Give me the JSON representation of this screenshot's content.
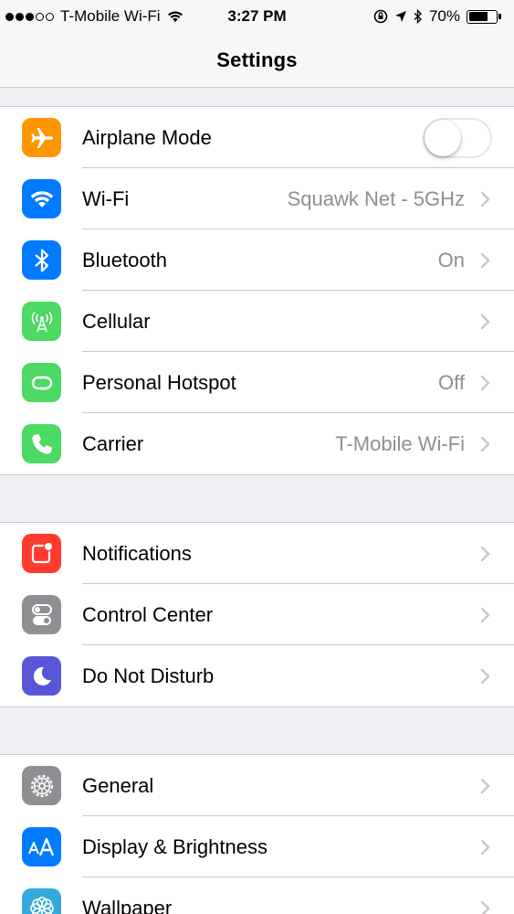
{
  "status_bar": {
    "carrier": "T-Mobile Wi-Fi",
    "time": "3:27 PM",
    "battery": "70%",
    "battery_level": 0.7,
    "signal_bars_filled": 3,
    "signal_bars_total": 5
  },
  "nav": {
    "title": "Settings"
  },
  "groups": [
    {
      "items": [
        {
          "label": "Airplane Mode",
          "icon": "airplane-icon",
          "color": "#ff9500",
          "toggle": false
        },
        {
          "label": "Wi-Fi",
          "value": "Squawk Net - 5GHz",
          "icon": "wifi-icon",
          "color": "#007aff"
        },
        {
          "label": "Bluetooth",
          "value": "On",
          "icon": "bluetooth-icon",
          "color": "#007aff"
        },
        {
          "label": "Cellular",
          "value": "",
          "icon": "cellular-icon",
          "color": "#4cd964"
        },
        {
          "label": "Personal Hotspot",
          "value": "Off",
          "icon": "hotspot-icon",
          "color": "#4cd964"
        },
        {
          "label": "Carrier",
          "value": "T-Mobile Wi-Fi",
          "icon": "phone-icon",
          "color": "#4cd964"
        }
      ]
    },
    {
      "items": [
        {
          "label": "Notifications",
          "icon": "notifications-icon",
          "color": "#ff3b30"
        },
        {
          "label": "Control Center",
          "icon": "control-center-icon",
          "color": "#8e8e93"
        },
        {
          "label": "Do Not Disturb",
          "icon": "moon-icon",
          "color": "#5856d6"
        }
      ]
    },
    {
      "items": [
        {
          "label": "General",
          "icon": "gear-icon",
          "color": "#8e8e93"
        },
        {
          "label": "Display & Brightness",
          "icon": "text-size-icon",
          "color": "#007aff"
        },
        {
          "label": "Wallpaper",
          "icon": "wallpaper-icon",
          "color": "#34aadc"
        }
      ]
    }
  ]
}
